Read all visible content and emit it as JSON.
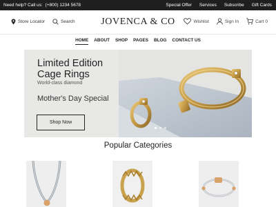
{
  "topbar": {
    "help_text": "Need help? Call us:",
    "phone": "(+800) 1234 5678",
    "links": [
      "Special Offer",
      "Services",
      "Subscribe",
      "Gift Cards"
    ]
  },
  "header": {
    "store_locator": "Store Locator",
    "search": "Search",
    "logo": "JOVENCA & CO",
    "wishlist": "Wishlist",
    "sign_in": "Sign In",
    "cart": "Cart",
    "cart_count": "0"
  },
  "nav": {
    "items": [
      "HOME",
      "ABOUT",
      "SHOP",
      "PAGES",
      "BLOG",
      "CONTACT US"
    ],
    "active": "HOME"
  },
  "hero": {
    "title_line1": "Limited Edition",
    "title_line2": "Cage Rings",
    "subtitle": "World-class diamond",
    "promo": "Mother's Day Special",
    "button": "Shop Now",
    "slide_count": 3,
    "active_slide": 1
  },
  "categories": {
    "title": "Popular Categories",
    "items": [
      {
        "icon": "necklace-image"
      },
      {
        "icon": "ring-image"
      },
      {
        "icon": "bracelet-image"
      }
    ]
  },
  "colors": {
    "topbar_bg": "#1f1f1f",
    "gold": "#c9a24e",
    "hero_bg": "#e8e8e6"
  }
}
